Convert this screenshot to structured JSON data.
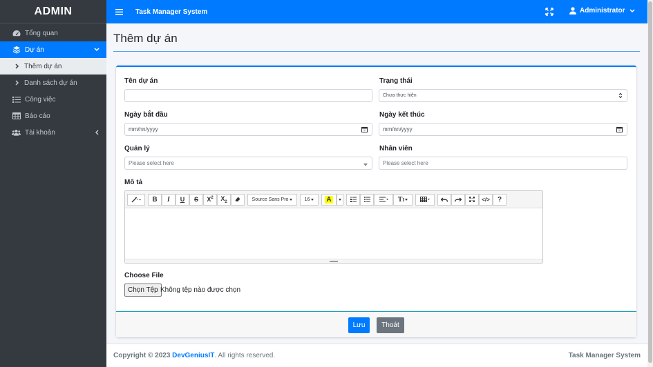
{
  "sidebar": {
    "brand": "ADMIN",
    "items": [
      {
        "label": "Tổng quan",
        "icon": "dashboard-icon"
      },
      {
        "label": "Dự án",
        "icon": "layers-icon"
      },
      {
        "label": "Thêm dự án",
        "icon": "chevron-right-icon"
      },
      {
        "label": "Danh sách dự án",
        "icon": "chevron-right-icon"
      },
      {
        "label": "Công việc",
        "icon": "tasks-icon"
      },
      {
        "label": "Báo cáo",
        "icon": "table-icon"
      },
      {
        "label": "Tài khoản",
        "icon": "users-icon"
      }
    ]
  },
  "topbar": {
    "title": "Task Manager System",
    "user": "Administrator"
  },
  "page": {
    "title": "Thêm dự án"
  },
  "form": {
    "name_label": "Tên dự án",
    "name_value": "",
    "status_label": "Trạng thái",
    "status_value": "Chưa thực hiện",
    "start_label": "Ngày bắt đầu",
    "start_placeholder": "mm/nn/yyyy",
    "end_label": "Ngày kết thúc",
    "end_placeholder": "mm/nn/yyyy",
    "manager_label": "Quản lý",
    "manager_placeholder": "Please select here",
    "staff_label": "Nhân viên",
    "staff_placeholder": "Please select here",
    "desc_label": "Mô tả",
    "font_name": "Source Sans Pro",
    "font_size": "16",
    "file_label": "Choose File",
    "file_button": "Chọn Tệp",
    "file_status": "Không tệp nào được chọn",
    "save_button": "Lưu",
    "exit_button": "Thoát"
  },
  "footer": {
    "copyright_prefix": "Copyright © 2023",
    "company": "DevGeniusIT",
    "suffix": ". All rights reserved.",
    "right": "Task Manager System"
  },
  "colors": {
    "primary": "#007bff",
    "sidebar": "#343a40",
    "secondary": "#6c757d"
  }
}
